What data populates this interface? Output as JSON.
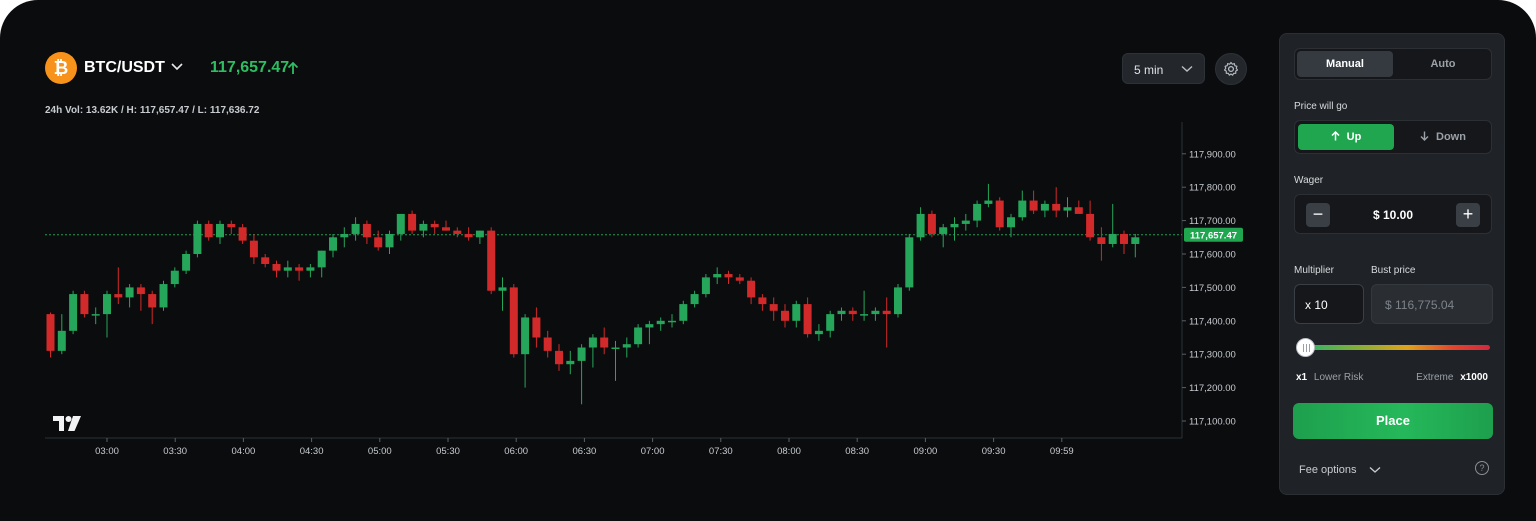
{
  "header": {
    "coin_symbol": "₿",
    "pair": "BTC/USDT",
    "price": "117,657.47",
    "stats": "24h Vol: 13.62K / H: 117,657.47 / L: 117,636.72",
    "interval": "5 min"
  },
  "panel": {
    "mode_tabs": [
      "Manual",
      "Auto"
    ],
    "active_mode": "Manual",
    "direction_label": "Price will go",
    "up_label": "Up",
    "down_label": "Down",
    "wager_label": "Wager",
    "wager_value": "$ 10.00",
    "minus": "−",
    "plus": "+",
    "multiplier_label": "Multiplier",
    "multiplier_value": "x 10",
    "bust_label": "Bust price",
    "bust_value": "$ 116,775.04",
    "slider_level": 0,
    "risk_min_value": "x1",
    "risk_min_text": "Lower Risk",
    "risk_max_text": "Extreme",
    "risk_max_value": "x1000",
    "place_label": "Place",
    "fee_label": "Fee options",
    "help": "?"
  },
  "colors": {
    "up": "#26a65b",
    "down": "#d22a2a",
    "accent_green": "#2ebd62"
  },
  "chart_data": {
    "type": "candlestick",
    "x_labels": [
      "03:00",
      "03:30",
      "04:00",
      "04:30",
      "05:00",
      "05:30",
      "06:00",
      "06:30",
      "07:00",
      "07:30",
      "08:00",
      "08:30",
      "09:00",
      "09:30",
      "09:59"
    ],
    "y_ticks": [
      117100,
      117200,
      117300,
      117400,
      117500,
      117600,
      117700,
      117800,
      117900
    ],
    "y_tick_labels": [
      "117,100.00",
      "117,200.00",
      "117,300.00",
      "117,400.00",
      "117,500.00",
      "117,600.00",
      "117,700.00",
      "117,800.00",
      "117,900.00"
    ],
    "ylim": [
      117040,
      117990
    ],
    "current_price": 117657.47,
    "current_price_label": "117,657.47",
    "candles": [
      {
        "o": 117420,
        "h": 117425,
        "l": 117290,
        "c": 117310
      },
      {
        "o": 117310,
        "h": 117420,
        "l": 117300,
        "c": 117370
      },
      {
        "o": 117370,
        "h": 117490,
        "l": 117360,
        "c": 117480
      },
      {
        "o": 117480,
        "h": 117490,
        "l": 117410,
        "c": 117420
      },
      {
        "o": 117420,
        "h": 117440,
        "l": 117390,
        "c": 117420
      },
      {
        "o": 117420,
        "h": 117490,
        "l": 117350,
        "c": 117480
      },
      {
        "o": 117480,
        "h": 117560,
        "l": 117450,
        "c": 117470
      },
      {
        "o": 117470,
        "h": 117510,
        "l": 117440,
        "c": 117500
      },
      {
        "o": 117500,
        "h": 117510,
        "l": 117430,
        "c": 117480
      },
      {
        "o": 117480,
        "h": 117490,
        "l": 117390,
        "c": 117440
      },
      {
        "o": 117440,
        "h": 117520,
        "l": 117430,
        "c": 117510
      },
      {
        "o": 117510,
        "h": 117560,
        "l": 117500,
        "c": 117550
      },
      {
        "o": 117550,
        "h": 117610,
        "l": 117540,
        "c": 117600
      },
      {
        "o": 117600,
        "h": 117700,
        "l": 117590,
        "c": 117690
      },
      {
        "o": 117690,
        "h": 117700,
        "l": 117640,
        "c": 117650
      },
      {
        "o": 117650,
        "h": 117700,
        "l": 117630,
        "c": 117690
      },
      {
        "o": 117690,
        "h": 117700,
        "l": 117660,
        "c": 117680
      },
      {
        "o": 117680,
        "h": 117690,
        "l": 117630,
        "c": 117640
      },
      {
        "o": 117640,
        "h": 117660,
        "l": 117570,
        "c": 117590
      },
      {
        "o": 117590,
        "h": 117600,
        "l": 117560,
        "c": 117570
      },
      {
        "o": 117570,
        "h": 117580,
        "l": 117530,
        "c": 117550
      },
      {
        "o": 117550,
        "h": 117580,
        "l": 117530,
        "c": 117560
      },
      {
        "o": 117560,
        "h": 117570,
        "l": 117520,
        "c": 117550
      },
      {
        "o": 117550,
        "h": 117570,
        "l": 117530,
        "c": 117560
      },
      {
        "o": 117560,
        "h": 117610,
        "l": 117530,
        "c": 117610
      },
      {
        "o": 117610,
        "h": 117660,
        "l": 117590,
        "c": 117650
      },
      {
        "o": 117650,
        "h": 117680,
        "l": 117620,
        "c": 117660
      },
      {
        "o": 117660,
        "h": 117710,
        "l": 117640,
        "c": 117690
      },
      {
        "o": 117690,
        "h": 117700,
        "l": 117630,
        "c": 117650
      },
      {
        "o": 117650,
        "h": 117670,
        "l": 117610,
        "c": 117620
      },
      {
        "o": 117620,
        "h": 117670,
        "l": 117600,
        "c": 117660
      },
      {
        "o": 117660,
        "h": 117720,
        "l": 117640,
        "c": 117720
      },
      {
        "o": 117720,
        "h": 117730,
        "l": 117660,
        "c": 117670
      },
      {
        "o": 117670,
        "h": 117700,
        "l": 117650,
        "c": 117690
      },
      {
        "o": 117690,
        "h": 117700,
        "l": 117660,
        "c": 117680
      },
      {
        "o": 117680,
        "h": 117700,
        "l": 117670,
        "c": 117670
      },
      {
        "o": 117670,
        "h": 117680,
        "l": 117650,
        "c": 117660
      },
      {
        "o": 117660,
        "h": 117680,
        "l": 117640,
        "c": 117650
      },
      {
        "o": 117650,
        "h": 117670,
        "l": 117630,
        "c": 117670
      },
      {
        "o": 117670,
        "h": 117680,
        "l": 117480,
        "c": 117490
      },
      {
        "o": 117490,
        "h": 117530,
        "l": 117430,
        "c": 117500
      },
      {
        "o": 117500,
        "h": 117510,
        "l": 117290,
        "c": 117300
      },
      {
        "o": 117300,
        "h": 117420,
        "l": 117200,
        "c": 117410
      },
      {
        "o": 117410,
        "h": 117440,
        "l": 117320,
        "c": 117350
      },
      {
        "o": 117350,
        "h": 117370,
        "l": 117290,
        "c": 117310
      },
      {
        "o": 117310,
        "h": 117330,
        "l": 117250,
        "c": 117270
      },
      {
        "o": 117270,
        "h": 117310,
        "l": 117240,
        "c": 117280
      },
      {
        "o": 117280,
        "h": 117330,
        "l": 117150,
        "c": 117320
      },
      {
        "o": 117320,
        "h": 117360,
        "l": 117260,
        "c": 117350
      },
      {
        "o": 117350,
        "h": 117380,
        "l": 117300,
        "c": 117320
      },
      {
        "o": 117320,
        "h": 117340,
        "l": 117220,
        "c": 117320
      },
      {
        "o": 117320,
        "h": 117350,
        "l": 117290,
        "c": 117330
      },
      {
        "o": 117330,
        "h": 117390,
        "l": 117320,
        "c": 117380
      },
      {
        "o": 117380,
        "h": 117400,
        "l": 117330,
        "c": 117390
      },
      {
        "o": 117390,
        "h": 117410,
        "l": 117370,
        "c": 117400
      },
      {
        "o": 117400,
        "h": 117420,
        "l": 117380,
        "c": 117400
      },
      {
        "o": 117400,
        "h": 117460,
        "l": 117390,
        "c": 117450
      },
      {
        "o": 117450,
        "h": 117490,
        "l": 117440,
        "c": 117480
      },
      {
        "o": 117480,
        "h": 117540,
        "l": 117470,
        "c": 117530
      },
      {
        "o": 117530,
        "h": 117560,
        "l": 117510,
        "c": 117540
      },
      {
        "o": 117540,
        "h": 117550,
        "l": 117510,
        "c": 117530
      },
      {
        "o": 117530,
        "h": 117540,
        "l": 117510,
        "c": 117520
      },
      {
        "o": 117520,
        "h": 117530,
        "l": 117450,
        "c": 117470
      },
      {
        "o": 117470,
        "h": 117480,
        "l": 117430,
        "c": 117450
      },
      {
        "o": 117450,
        "h": 117470,
        "l": 117400,
        "c": 117430
      },
      {
        "o": 117430,
        "h": 117450,
        "l": 117380,
        "c": 117400
      },
      {
        "o": 117400,
        "h": 117460,
        "l": 117380,
        "c": 117450
      },
      {
        "o": 117450,
        "h": 117470,
        "l": 117350,
        "c": 117360
      },
      {
        "o": 117360,
        "h": 117390,
        "l": 117340,
        "c": 117370
      },
      {
        "o": 117370,
        "h": 117430,
        "l": 117350,
        "c": 117420
      },
      {
        "o": 117420,
        "h": 117440,
        "l": 117400,
        "c": 117430
      },
      {
        "o": 117430,
        "h": 117440,
        "l": 117400,
        "c": 117420
      },
      {
        "o": 117420,
        "h": 117490,
        "l": 117400,
        "c": 117420
      },
      {
        "o": 117420,
        "h": 117440,
        "l": 117400,
        "c": 117430
      },
      {
        "o": 117430,
        "h": 117470,
        "l": 117320,
        "c": 117420
      },
      {
        "o": 117420,
        "h": 117510,
        "l": 117410,
        "c": 117500
      },
      {
        "o": 117500,
        "h": 117660,
        "l": 117490,
        "c": 117650
      },
      {
        "o": 117650,
        "h": 117740,
        "l": 117640,
        "c": 117720
      },
      {
        "o": 117720,
        "h": 117730,
        "l": 117650,
        "c": 117660
      },
      {
        "o": 117660,
        "h": 117690,
        "l": 117620,
        "c": 117680
      },
      {
        "o": 117680,
        "h": 117710,
        "l": 117640,
        "c": 117690
      },
      {
        "o": 117690,
        "h": 117720,
        "l": 117670,
        "c": 117700
      },
      {
        "o": 117700,
        "h": 117760,
        "l": 117680,
        "c": 117750
      },
      {
        "o": 117750,
        "h": 117810,
        "l": 117740,
        "c": 117760
      },
      {
        "o": 117760,
        "h": 117770,
        "l": 117670,
        "c": 117680
      },
      {
        "o": 117680,
        "h": 117720,
        "l": 117650,
        "c": 117710
      },
      {
        "o": 117710,
        "h": 117790,
        "l": 117700,
        "c": 117760
      },
      {
        "o": 117760,
        "h": 117790,
        "l": 117720,
        "c": 117730
      },
      {
        "o": 117730,
        "h": 117760,
        "l": 117710,
        "c": 117750
      },
      {
        "o": 117750,
        "h": 117800,
        "l": 117710,
        "c": 117730
      },
      {
        "o": 117730,
        "h": 117770,
        "l": 117710,
        "c": 117740
      },
      {
        "o": 117740,
        "h": 117760,
        "l": 117720,
        "c": 117720
      },
      {
        "o": 117720,
        "h": 117760,
        "l": 117640,
        "c": 117650
      },
      {
        "o": 117650,
        "h": 117680,
        "l": 117580,
        "c": 117630
      },
      {
        "o": 117630,
        "h": 117750,
        "l": 117620,
        "c": 117660
      },
      {
        "o": 117660,
        "h": 117670,
        "l": 117600,
        "c": 117630
      },
      {
        "o": 117630,
        "h": 117660,
        "l": 117590,
        "c": 117650
      }
    ]
  }
}
